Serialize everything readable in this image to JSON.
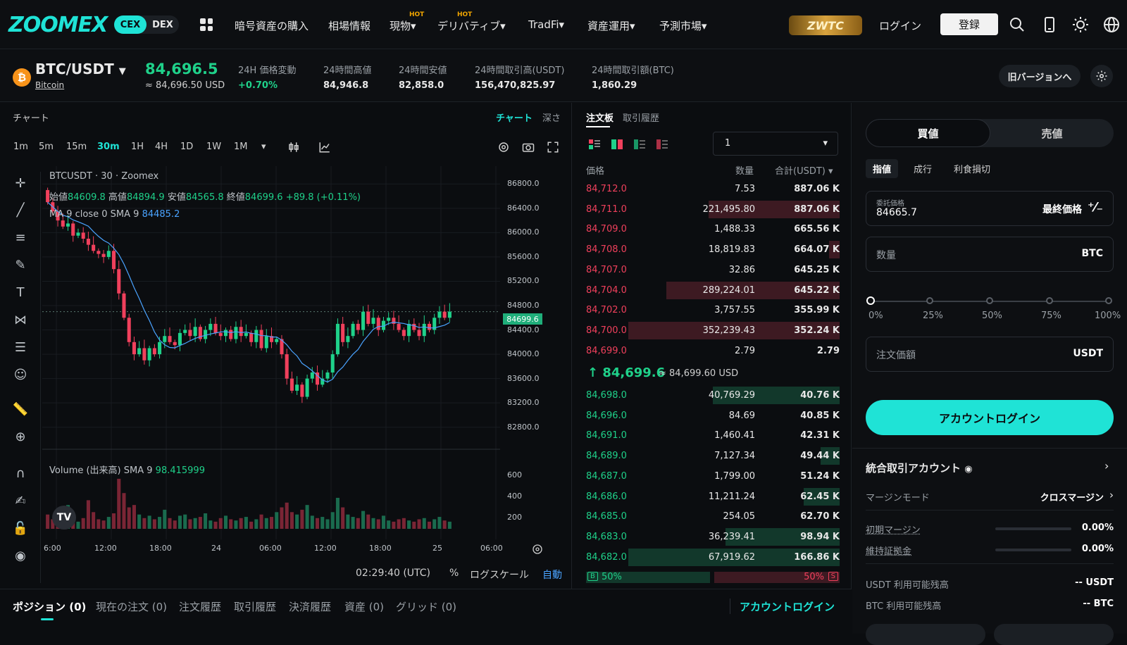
{
  "nav": {
    "logo": "ZOOMEX",
    "cex": "CEX",
    "dex": "DEX",
    "items": [
      {
        "label": "暗号資産の購入",
        "hot": ""
      },
      {
        "label": "相場情報",
        "hot": ""
      },
      {
        "label": "現物▾",
        "hot": "HOT"
      },
      {
        "label": "デリバティブ▾",
        "hot": "HOT"
      },
      {
        "label": "TradFi▾",
        "hot": ""
      },
      {
        "label": "資産運用▾",
        "hot": ""
      },
      {
        "label": "予測市場▾",
        "hot": ""
      }
    ],
    "promo": "ZWTC",
    "login": "ログイン",
    "register": "登録"
  },
  "ticker": {
    "coin_glyph": "₿",
    "pair": "BTC/USDT",
    "coin_name": "Bitcoin",
    "last": "84,696.5",
    "last_usd": "≈ 84,696.50 USD",
    "stats": [
      {
        "label": "24H 価格変動",
        "value": "+0.70%",
        "color": "#1fd18a"
      },
      {
        "label": "24時間高値",
        "value": "84,946.8",
        "color": "#e8e8e8"
      },
      {
        "label": "24時間安値",
        "value": "82,858.0",
        "color": "#e8e8e8"
      },
      {
        "label": "24時間取引高(USDT)",
        "value": "156,470,825.97",
        "color": "#e8e8e8"
      },
      {
        "label": "24時間取引額(BTC)",
        "value": "1,860.29",
        "color": "#e8e8e8"
      }
    ],
    "old_version": "旧バージョンへ"
  },
  "chart": {
    "label": "チャート",
    "tab_chart": "チャート",
    "tab_depth": "深さ",
    "timeframes": [
      "1m",
      "5m",
      "15m",
      "30m",
      "1H",
      "4H",
      "1D",
      "1W",
      "1M"
    ],
    "active_tf": "30m",
    "symbol_line": "BTCUSDT · 30 · Zoomex",
    "ohlc_open_k": "始値",
    "ohlc_open": "84609.8",
    "ohlc_high_k": "高値",
    "ohlc_high": "84894.9",
    "ohlc_low_k": "安値",
    "ohlc_low": "84565.8",
    "ohlc_close_k": "終値",
    "ohlc_close": "84699.6",
    "ohlc_change": "+89.8 (+0.11%)",
    "ma_label": "MA 9 close 0 SMA 9",
    "ma_value": "84485.2",
    "vol_label": "Volume (出来高) SMA 9",
    "vol_value": "98.415999",
    "price_tag": "84699.6",
    "tv_logo": "TV",
    "time": "02:29:40 (UTC)",
    "pct": "%",
    "log": "ログスケール",
    "auto": "自動"
  },
  "chart_data": {
    "type": "candlestick",
    "y_ticks": [
      "86800.0",
      "86400.0",
      "86000.0",
      "85600.0",
      "85200.0",
      "84800.0",
      "84400.0",
      "84000.0",
      "83600.0",
      "83200.0",
      "82800.0"
    ],
    "ylim": [
      82600,
      87000
    ],
    "x_ticks": [
      "6:00",
      "12:00",
      "18:00",
      "24",
      "06:00",
      "12:00",
      "18:00",
      "25",
      "06:00"
    ],
    "vol_ticks": [
      "600",
      "400",
      "200"
    ],
    "close_series": [
      86500,
      86350,
      86200,
      86100,
      86150,
      85950,
      86000,
      85900,
      85800,
      85700,
      85650,
      85600,
      85700,
      85400,
      85000,
      84600,
      84200,
      84000,
      84100,
      83900,
      84100,
      84000,
      84200,
      84300,
      84200,
      84150,
      84350,
      84400,
      84300,
      84450,
      84250,
      84400,
      84500,
      84350,
      84300,
      84400,
      84250,
      84450,
      84300,
      84350,
      84200,
      84400,
      84100,
      84300,
      84200,
      84250,
      84000,
      83600,
      83400,
      83500,
      83300,
      83600,
      83700,
      83500,
      83600,
      83700,
      84000,
      84500,
      84200,
      84300,
      84500,
      84400,
      84700,
      84500,
      84600,
      84400,
      84550,
      84600,
      84500,
      84400,
      84300,
      84500,
      84400,
      84300,
      84500,
      84400,
      84600,
      84700,
      84600,
      84700
    ],
    "volume_series": [
      120,
      80,
      150,
      90,
      200,
      110,
      60,
      90,
      240,
      140,
      80,
      70,
      100,
      130,
      420,
      300,
      180,
      200,
      120,
      90,
      110,
      80,
      100,
      160,
      90,
      70,
      110,
      120,
      80,
      90,
      100,
      130,
      70,
      60,
      90,
      110,
      80,
      70,
      90,
      100,
      60,
      80,
      120,
      90,
      100,
      140,
      180,
      220,
      140,
      120,
      160,
      200,
      110,
      90,
      100,
      80,
      140,
      260,
      180,
      120,
      100,
      90,
      150,
      120,
      90,
      80,
      110,
      70,
      60,
      80,
      90,
      70,
      60,
      80,
      90,
      60,
      80,
      100,
      70,
      60
    ]
  },
  "book": {
    "tab_book": "注文板",
    "tab_trades": "取引履歴",
    "depth": "1",
    "col_price": "価格",
    "col_qty": "数量",
    "col_total": "合計(USDT) ▾",
    "asks": [
      {
        "p": "84,712.0",
        "q": "7.53",
        "t": "887.06 K",
        "w": 0
      },
      {
        "p": "84,711.0",
        "q": "221,495.80",
        "t": "887.06 K",
        "w": 0.62
      },
      {
        "p": "84,709.0",
        "q": "1,488.33",
        "t": "665.56 K",
        "w": 0
      },
      {
        "p": "84,708.0",
        "q": "18,819.83",
        "t": "664.07 K",
        "w": 0.05
      },
      {
        "p": "84,707.0",
        "q": "32.86",
        "t": "645.25 K",
        "w": 0
      },
      {
        "p": "84,704.0",
        "q": "289,224.01",
        "t": "645.22 K",
        "w": 0.82
      },
      {
        "p": "84,702.0",
        "q": "3,757.55",
        "t": "355.99 K",
        "w": 0
      },
      {
        "p": "84,700.0",
        "q": "352,239.43",
        "t": "352.24 K",
        "w": 1.0
      },
      {
        "p": "84,699.0",
        "q": "2.79",
        "t": "2.79",
        "w": 0
      }
    ],
    "mid": "↑ 84,699.6",
    "mid_usd": "≈ 84,699.60 USD",
    "bids": [
      {
        "p": "84,698.0",
        "q": "40,769.29",
        "t": "40.76 K",
        "w": 0.6
      },
      {
        "p": "84,696.0",
        "q": "84.69",
        "t": "40.85 K",
        "w": 0
      },
      {
        "p": "84,691.0",
        "q": "1,460.41",
        "t": "42.31 K",
        "w": 0
      },
      {
        "p": "84,689.0",
        "q": "7,127.34",
        "t": "49.44 K",
        "w": 0.09
      },
      {
        "p": "84,687.0",
        "q": "1,799.00",
        "t": "51.24 K",
        "w": 0
      },
      {
        "p": "84,686.0",
        "q": "11,211.24",
        "t": "62.45 K",
        "w": 0.17
      },
      {
        "p": "84,685.0",
        "q": "254.05",
        "t": "62.70 K",
        "w": 0
      },
      {
        "p": "84,683.0",
        "q": "36,239.41",
        "t": "98.94 K",
        "w": 0.54
      },
      {
        "p": "84,682.0",
        "q": "67,919.62",
        "t": "166.86 K",
        "w": 1.0
      }
    ],
    "buy_badge": "B",
    "buy_pct": "50%",
    "sell_pct": "50%",
    "sell_badge": "S"
  },
  "order": {
    "buy": "買値",
    "sell": "売値",
    "types": [
      "指値",
      "成行",
      "利食損切"
    ],
    "price_label": "委託価格",
    "price_value": "84665.7",
    "price_right": "最終価格",
    "qty_label": "数量",
    "qty_unit": "BTC",
    "slider_marks": [
      "0%",
      "25%",
      "50%",
      "75%",
      "100%"
    ],
    "amount_label": "注文価額",
    "amount_unit": "USDT",
    "login_btn": "アカウントログイン"
  },
  "account": {
    "title": "統合取引アカウント",
    "margin_mode_label": "マージンモード",
    "margin_mode": "クロスマージン",
    "im_label": "初期マージン",
    "im_value": "0.00%",
    "mm_label": "維持証拠金",
    "mm_value": "0.00%",
    "usdt_label": "USDT 利用可能残高",
    "usdt_value": "-- USDT",
    "btc_label": "BTC 利用可能残高",
    "btc_value": "-- BTC"
  },
  "bottom": {
    "tabs": [
      "ポジション (0)",
      "現在の注文 (0)",
      "注文履歴",
      "取引履歴",
      "決済履歴",
      "資産 (0)",
      "グリッド (0)"
    ],
    "account_login": "アカウントログイン"
  },
  "colors": {
    "accent": "#1fe3d6",
    "up": "#1fd18a",
    "down": "#f0405c",
    "bg": "#0b0d10"
  }
}
